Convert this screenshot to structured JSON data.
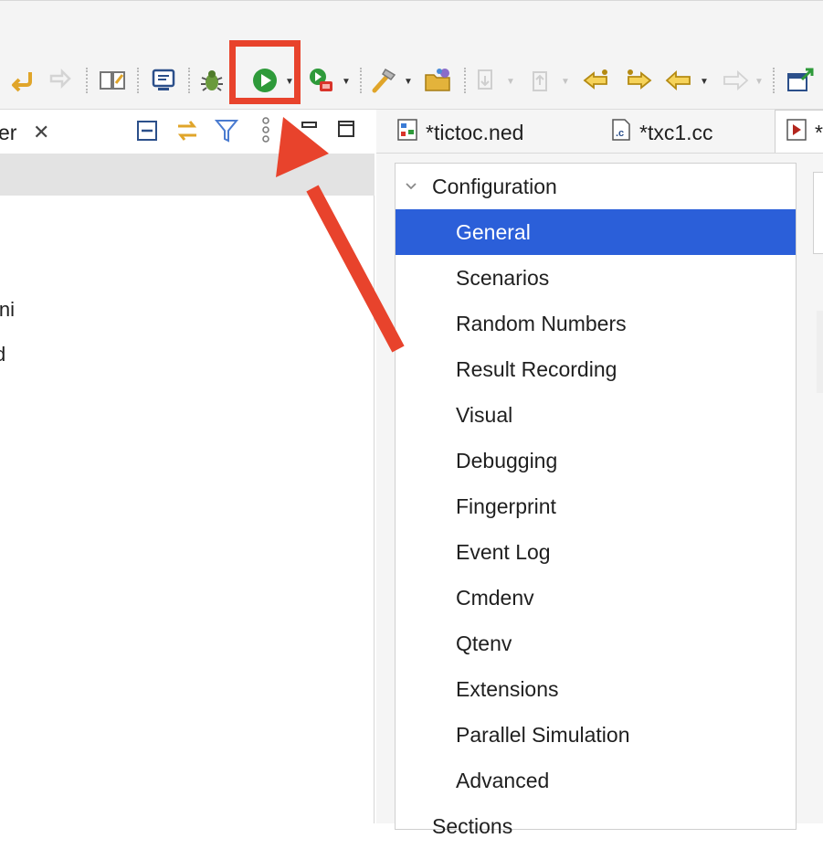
{
  "toolbar": {
    "icons": [
      "back-arrow-icon",
      "forward-arrow-icon",
      "book-icon",
      "monitor-icon",
      "bug-icon",
      "run-icon",
      "coverage-icon",
      "hammer-icon",
      "folder-icon",
      "download-icon",
      "upload-icon",
      "prev-annotation-icon",
      "next-annotation-icon",
      "nav-back-icon",
      "nav-forward-icon",
      "open-perspective-icon"
    ],
    "accent": "#2e9a3a"
  },
  "left_panel": {
    "tab_label": "er",
    "close_glyph": "✕",
    "tree_items": [
      "ini",
      "d"
    ]
  },
  "editor_tabs": [
    {
      "label": "*tictoc.ned"
    },
    {
      "label": "*txc1.cc"
    },
    {
      "label": "*"
    }
  ],
  "nav_tree": {
    "header": "Configuration",
    "selected": "General",
    "items": [
      "General",
      "Scenarios",
      "Random Numbers",
      "Result Recording",
      "Visual",
      "Debugging",
      "Fingerprint",
      "Event Log",
      "Cmdenv",
      "Qtenv",
      "Extensions",
      "Parallel Simulation",
      "Advanced"
    ],
    "next_header": "Sections",
    "selected_color": "#2b5fd9"
  },
  "annotation": {
    "color": "#e8432c"
  }
}
